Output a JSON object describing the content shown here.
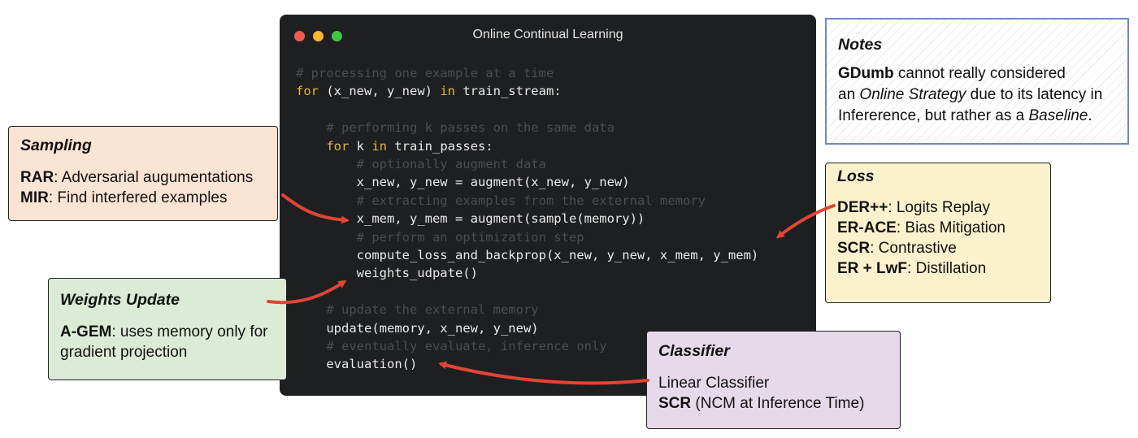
{
  "window": {
    "title": "Online Continual Learning",
    "code_lines": [
      {
        "indent": "",
        "text": "# processing one example at a time",
        "comment": true
      },
      {
        "indent": "",
        "kw": "for",
        "before": "",
        "after": " (x_new, y_new) ",
        "kw2": "in",
        "rest": " train_stream:"
      },
      {
        "indent": "",
        "text": "",
        "comment": false
      },
      {
        "indent": "    ",
        "text": "# performing k passes on the same data",
        "comment": true
      },
      {
        "indent": "    ",
        "kw": "for",
        "after": " k ",
        "kw2": "in",
        "rest": " train_passes:"
      },
      {
        "indent": "        ",
        "text": "# optionally augment data",
        "comment": true
      },
      {
        "indent": "        ",
        "text": "x_new, y_new = augment(x_new, y_new)",
        "comment": false
      },
      {
        "indent": "        ",
        "text": "# extracting examples from the external memory",
        "comment": true
      },
      {
        "indent": "        ",
        "text": "x_mem, y_mem = augment(sample(memory))",
        "comment": false
      },
      {
        "indent": "        ",
        "text": "# perform an optimization step",
        "comment": true
      },
      {
        "indent": "        ",
        "text": "compute_loss_and_backprop(x_new, y_new, x_mem, y_mem)",
        "comment": false
      },
      {
        "indent": "        ",
        "text": "weights_udpate()",
        "comment": false
      },
      {
        "indent": "",
        "text": "",
        "comment": false
      },
      {
        "indent": "    ",
        "text": "# update the external memory",
        "comment": true
      },
      {
        "indent": "    ",
        "text": "update(memory, x_new, y_new)",
        "comment": false
      },
      {
        "indent": "    ",
        "text": "# eventually evaluate, inference only",
        "comment": true
      },
      {
        "indent": "    ",
        "text": "evaluation()",
        "comment": false
      }
    ]
  },
  "sampling": {
    "title": "Sampling",
    "items": [
      {
        "key": "RAR",
        "text": ": Adversarial augumentations"
      },
      {
        "key": "MIR",
        "text": ": Find interfered examples"
      }
    ]
  },
  "weights": {
    "title": "Weights Update",
    "key": "A-GEM",
    "line1": ": uses memory only for",
    "line2": "gradient projection"
  },
  "classifier": {
    "title": "Classifier",
    "line1": "Linear Classifier",
    "key": "SCR",
    "line2": " (NCM at Inference Time)"
  },
  "loss": {
    "title": "Loss",
    "items": [
      {
        "key": "DER++",
        "text": ": Logits Replay"
      },
      {
        "key": "ER-ACE",
        "text": ": Bias Mitigation"
      },
      {
        "key": "SCR",
        "text": ": Contrastive"
      },
      {
        "key": "ER + LwF",
        "text": ": Distillation"
      }
    ]
  },
  "notes": {
    "title": "Notes",
    "key": "GDumb",
    "t1": " cannot really considered",
    "t2": "an ",
    "em1": "Online Strategy",
    "t3": " due to its latency in",
    "t4": "Infererence, but rather as a ",
    "em2": "Baseline",
    "t5": "."
  },
  "colors": {
    "arrow": "#e04535",
    "keyword": "#e2b93b",
    "comment": "#4b4d51",
    "window_bg": "#1e1f21"
  }
}
